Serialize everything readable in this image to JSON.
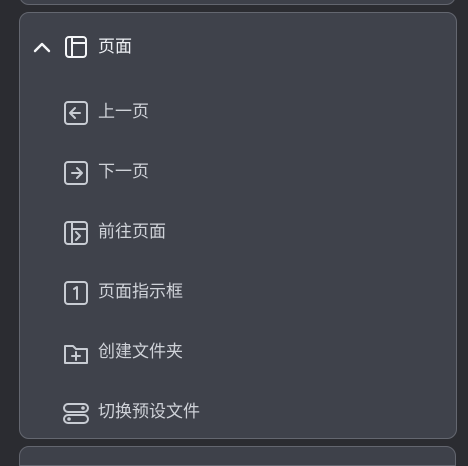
{
  "window": {
    "accent_color": "#3f424b"
  },
  "panel": {
    "title": "页面",
    "expanded": true,
    "items": [
      {
        "label": "上一页",
        "icon": "arrow-left-box-icon"
      },
      {
        "label": "下一页",
        "icon": "arrow-right-box-icon"
      },
      {
        "label": "前往页面",
        "icon": "go-to-page-icon"
      },
      {
        "label": "页面指示框",
        "icon": "number-box-icon"
      },
      {
        "label": "创建文件夹",
        "icon": "folder-plus-icon"
      },
      {
        "label": "切换预设文件",
        "icon": "toggle-switch-icon"
      }
    ]
  }
}
